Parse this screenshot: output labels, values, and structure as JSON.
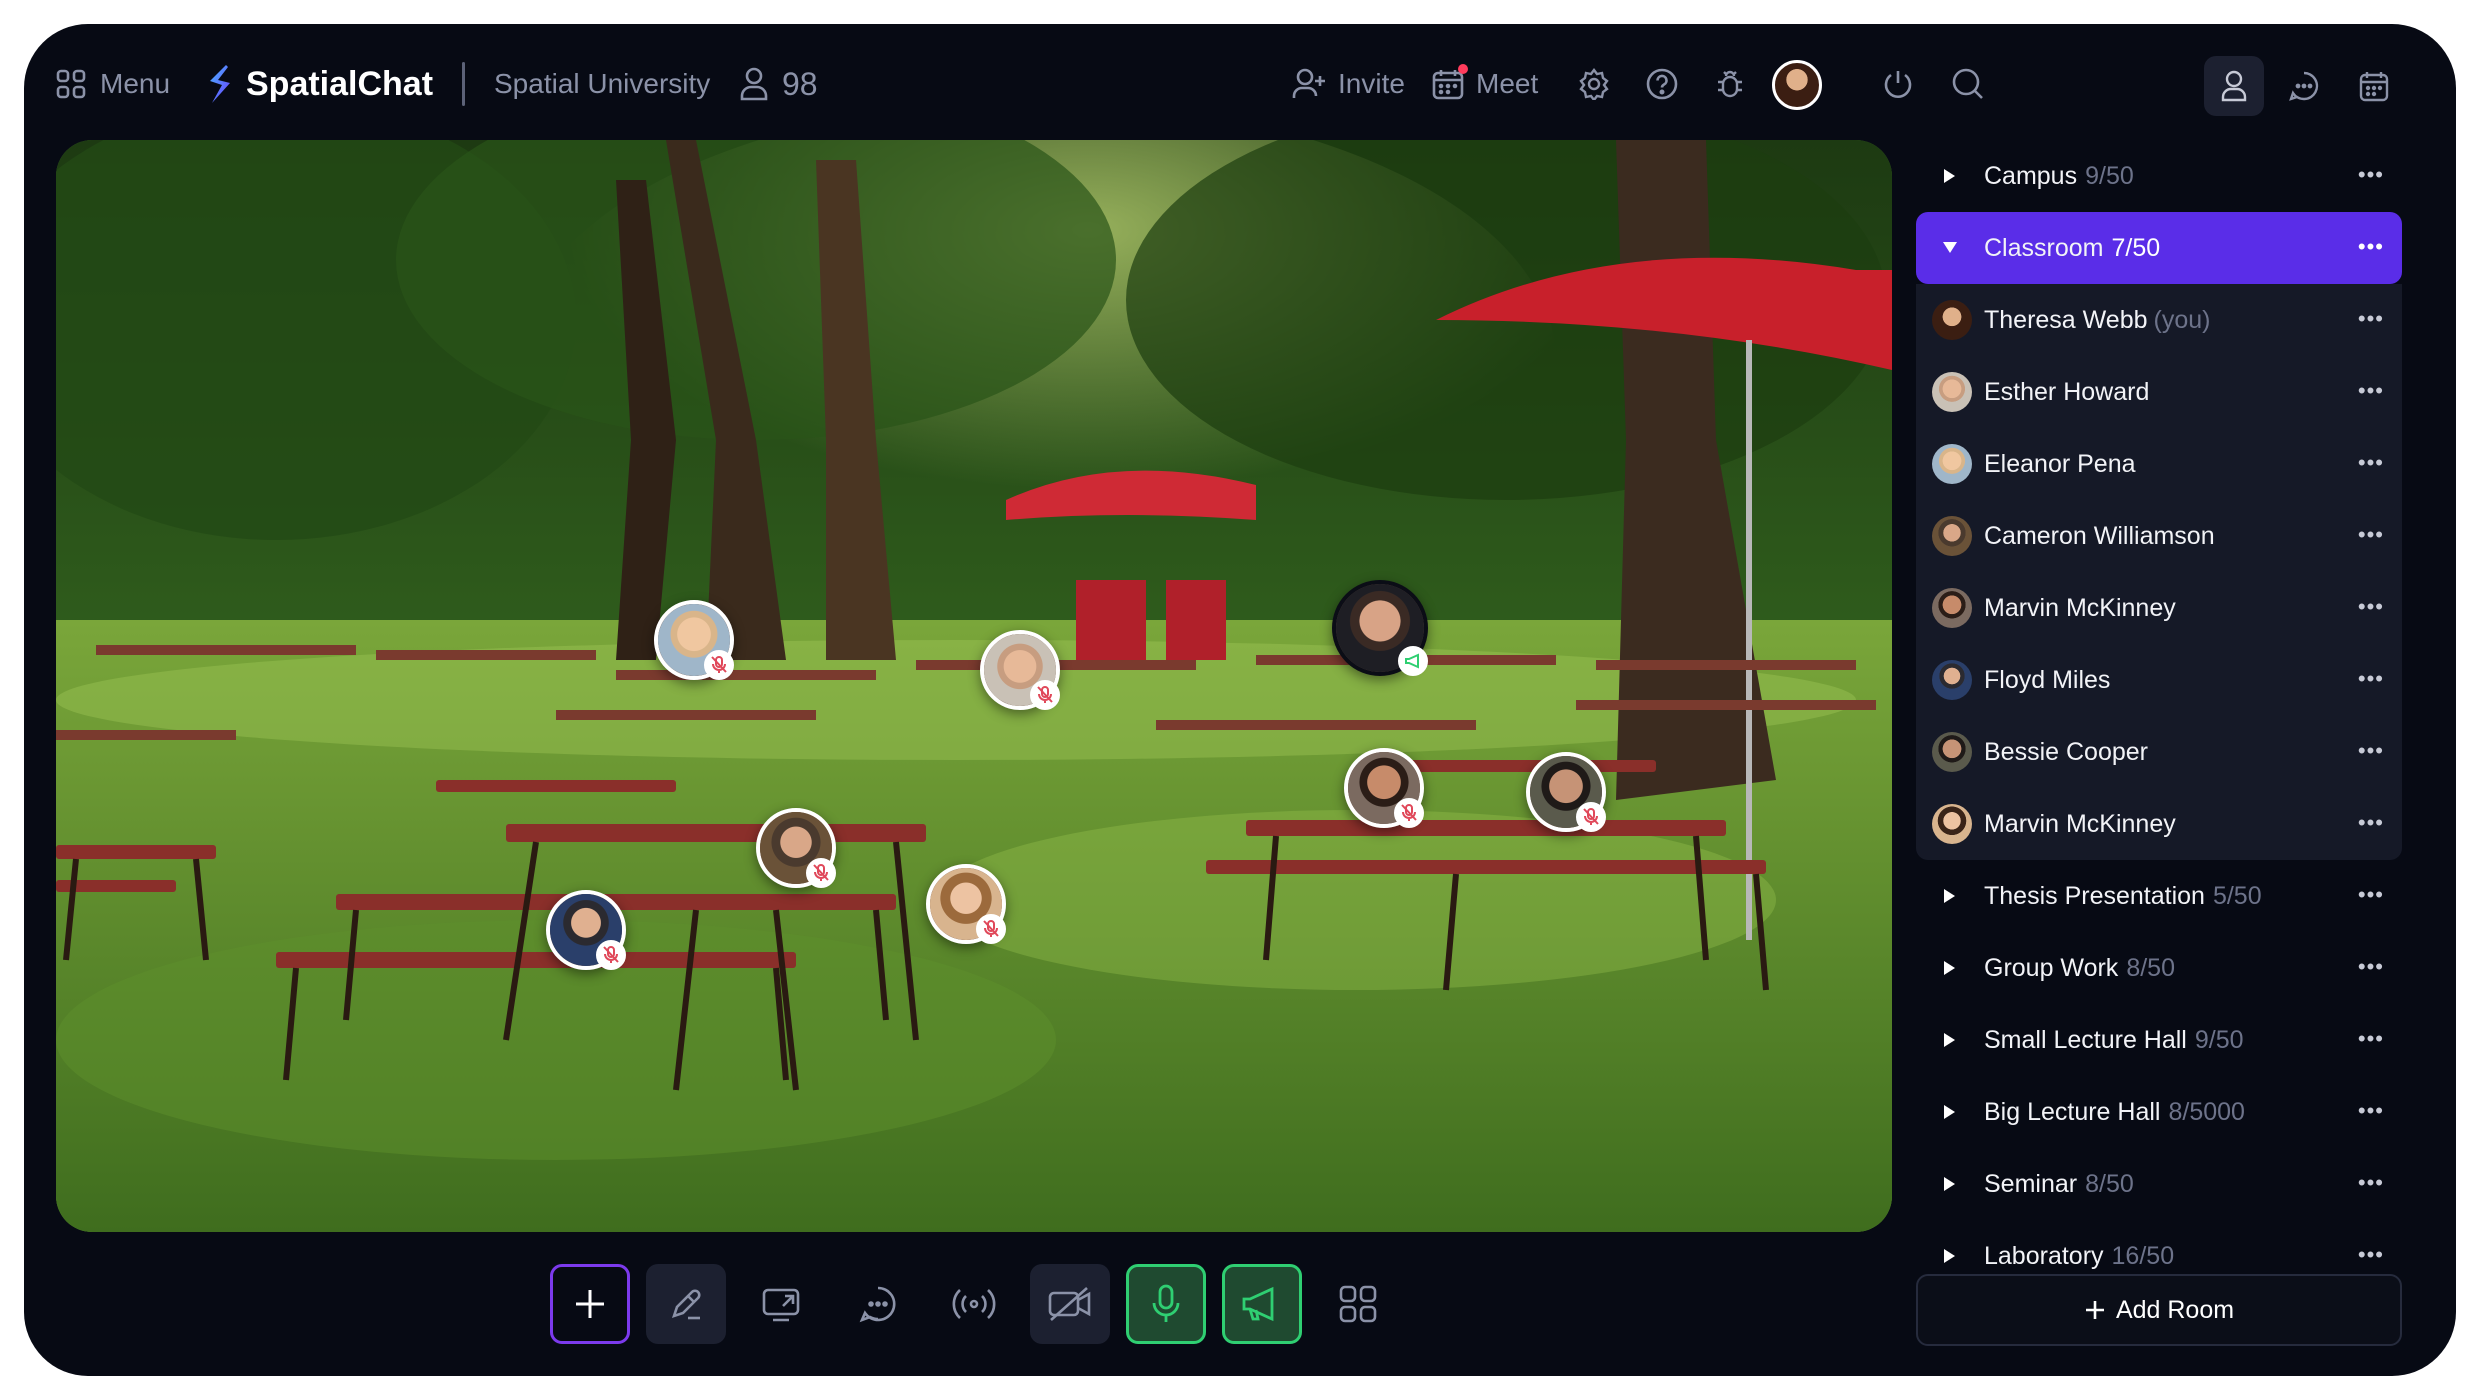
{
  "header": {
    "menu_label": "Menu",
    "brand_name": "SpatialChat",
    "space_name": "Spatial University",
    "people_count": "98",
    "invite_label": "Invite",
    "meet_label": "Meet"
  },
  "sidebar": {
    "rooms_before": [
      {
        "name": "Campus",
        "count": "9/50"
      }
    ],
    "active_room": {
      "name": "Classroom",
      "count": "7/50"
    },
    "members": [
      {
        "name": "Theresa Webb",
        "suffix": "(you)"
      },
      {
        "name": "Esther Howard"
      },
      {
        "name": "Eleanor Pena"
      },
      {
        "name": "Cameron Williamson"
      },
      {
        "name": "Marvin McKinney"
      },
      {
        "name": "Floyd Miles"
      },
      {
        "name": "Bessie Cooper"
      },
      {
        "name": "Marvin McKinney"
      }
    ],
    "rooms_after": [
      {
        "name": "Thesis Presentation",
        "count": "5/50"
      },
      {
        "name": "Group Work",
        "count": "8/50"
      },
      {
        "name": "Small Lecture Hall",
        "count": "9/50"
      },
      {
        "name": "Big Lecture Hall",
        "count": "8/5000"
      },
      {
        "name": "Seminar",
        "count": "8/50"
      },
      {
        "name": "Laboratory",
        "count": "16/50"
      }
    ],
    "more_label": "•••",
    "add_room_label": "Add Room"
  },
  "toolbar": {
    "tools": [
      "plus-icon",
      "pen-icon",
      "screen-share-icon",
      "chat-icon",
      "broadcast-icon",
      "camera-off-icon",
      "microphone-icon",
      "megaphone-icon",
      "apps-grid-icon"
    ]
  },
  "colors": {
    "background": "#070a14",
    "accent": "#5a2de8",
    "active_green": "#2fcf72",
    "panel": "#151927"
  }
}
